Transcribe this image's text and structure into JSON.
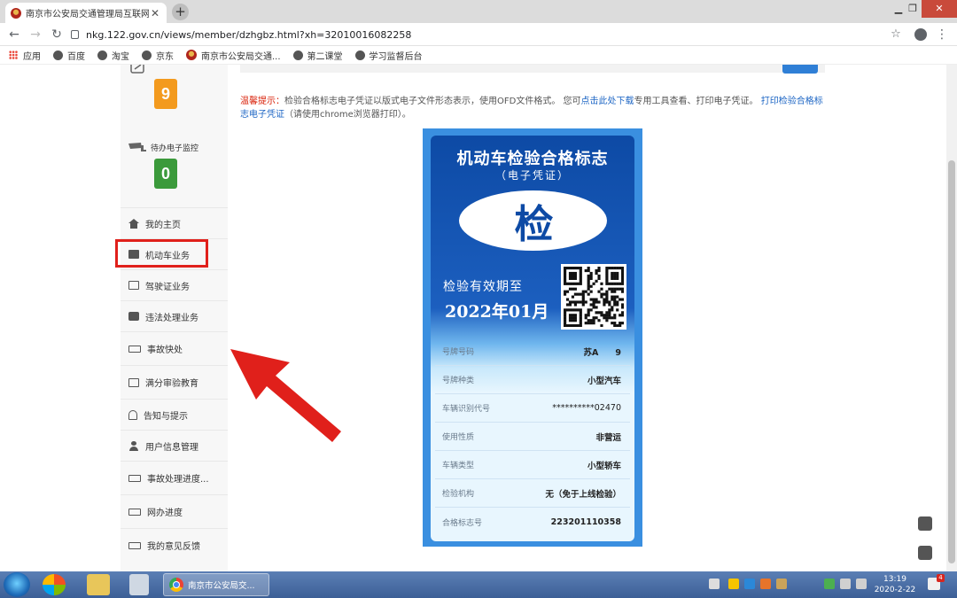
{
  "browser": {
    "tab_title": "南京市公安局交通管理局互联网",
    "url": "nkg.122.gov.cn/views/member/dzhgbz.html?xh=32010016082258",
    "bookmarks": [
      "应用",
      "百度",
      "淘宝",
      "京东",
      "南京市公安局交通...",
      "第二课堂",
      "学习监督后台"
    ]
  },
  "sidebar": {
    "stats": [
      {
        "label": "",
        "value": "9",
        "color": "#f39a1e"
      },
      {
        "label": "待办电子监控",
        "value": "0",
        "color": "#3b9a3b"
      }
    ],
    "items": [
      {
        "label": "我的主页",
        "icon": "home-icon"
      },
      {
        "label": "机动车业务",
        "icon": "truck-icon"
      },
      {
        "label": "驾驶证业务",
        "icon": "license-card-icon"
      },
      {
        "label": "违法处理业务",
        "icon": "camera-icon"
      },
      {
        "label": "事故快处",
        "icon": "car-icon"
      },
      {
        "label": "满分审验教育",
        "icon": "monitor-icon"
      },
      {
        "label": "告知与提示",
        "icon": "bell-icon"
      },
      {
        "label": "用户信息管理",
        "icon": "user-icon"
      },
      {
        "label": "事故处理进度...",
        "icon": "car-icon"
      },
      {
        "label": "网办进度",
        "icon": "car-icon"
      },
      {
        "label": "我的意见反馈",
        "icon": "feedback-icon"
      }
    ]
  },
  "notice": {
    "prefix": "温馨提示：",
    "text1": "检验合格标志电子凭证以版式电子文件形态表示，使用OFD文件格式。 您可",
    "link1": "点击此处下载",
    "text2": "专用工具查看、打印电子凭证。",
    "link2": "打印检验合格标志电子凭证",
    "text3": "（请使用chrome浏览器打印）。"
  },
  "certificate": {
    "title": "机动车检验合格标志",
    "subtitle": "（电子凭证）",
    "emblem": "检",
    "validity_label": "检验有效期至",
    "validity_date": "2022年01月",
    "fields": [
      {
        "key": "号牌号码",
        "value": "苏A　　9"
      },
      {
        "key": "号牌种类",
        "value": "小型汽车"
      },
      {
        "key": "车辆识别代号",
        "value": "**********02470"
      },
      {
        "key": "使用性质",
        "value": "非营运"
      },
      {
        "key": "车辆类型",
        "value": "小型轿车"
      },
      {
        "key": "检验机构",
        "value": "无（免于上线检验）"
      },
      {
        "key": "合格标志号",
        "value": "223201110358"
      }
    ],
    "colors": {
      "frame": "#3a8fe0",
      "header": "#0d4aa5",
      "body": "#e8f6fe"
    }
  },
  "taskbar": {
    "task_label": "南京市公安局交...",
    "time": "13:19",
    "date": "2020-2-22",
    "notification_count": "4"
  }
}
